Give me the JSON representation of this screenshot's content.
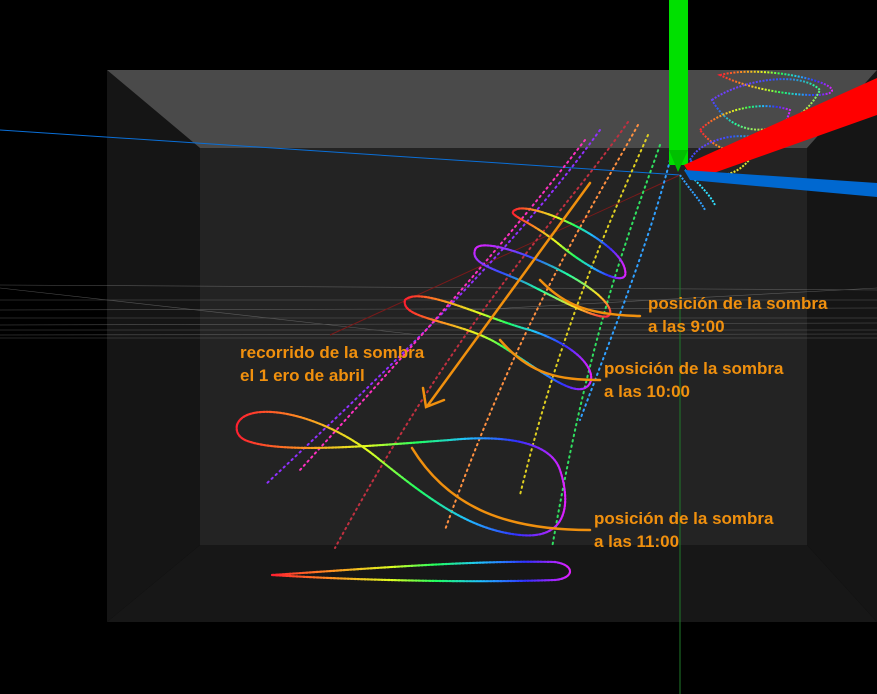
{
  "colors": {
    "background": "#000000",
    "annotation": "#f0900e",
    "axis_x": "#ff0000",
    "axis_y": "#00e000",
    "axis_z": "#0070d0",
    "box_top": "#4a4a4a",
    "box_back": "#232323",
    "box_side": "#151515"
  },
  "annotations": {
    "path_label": {
      "line1": "recorrido de la sombra",
      "line2": "el  1 ero de abril"
    },
    "shadow_9": {
      "line1": "posición de la sombra",
      "line2": "a las 9:00"
    },
    "shadow_10": {
      "line1": "posición de la sombra",
      "line2": "a las 10:00"
    },
    "shadow_11": {
      "line1": "posición de la sombra",
      "line2": "a las 11:00"
    }
  }
}
